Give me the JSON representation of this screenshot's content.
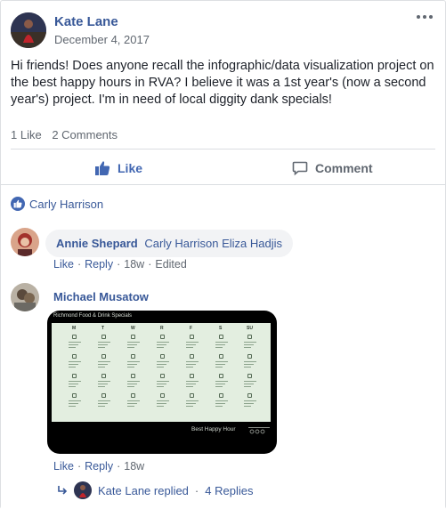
{
  "post": {
    "author": "Kate Lane",
    "date": "December 4, 2017",
    "text": "Hi friends! Does anyone recall the infographic/data visualization project on the best happy hours in RVA? I believe it was a 1st year's (now a second year's) project. I'm in need of local diggity dank specials!",
    "like_count": "1 Like",
    "comment_count": "2 Comments"
  },
  "actions": {
    "like": "Like",
    "comment": "Comment"
  },
  "reactions": {
    "reactor": "Carly Harrison"
  },
  "comments": [
    {
      "author": "Annie Shepard",
      "tags": [
        "Carly Harrison",
        "Eliza Hadjis"
      ],
      "like": "Like",
      "reply": "Reply",
      "age": "18w",
      "edited": "Edited"
    },
    {
      "author": "Michael Musatow",
      "like": "Like",
      "reply": "Reply",
      "age": "18w",
      "attachment": {
        "title": "Richmond Food & Drink Specials",
        "days": [
          "M",
          "T",
          "W",
          "R",
          "F",
          "S",
          "SU"
        ],
        "footer": "Best Happy Hour"
      }
    }
  ],
  "replies": {
    "summary": "Kate Lane replied",
    "count": "4 Replies"
  },
  "colors": {
    "link": "#385898",
    "like_blue": "#4267b2",
    "meta_gray": "#606770",
    "panel_green": "#e3eee0"
  },
  "icons": {
    "more": "more-dots-icon",
    "like": "thumbs-up-icon",
    "comment": "speech-bubble-icon",
    "reply_arrow": "reply-arrow-icon"
  }
}
